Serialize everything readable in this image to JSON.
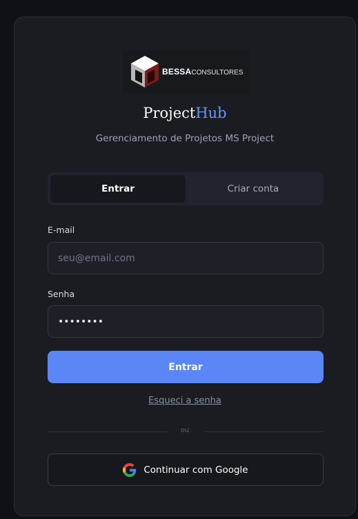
{
  "brand": {
    "logo_bold": "BESSA",
    "logo_light": "CONSULTORES"
  },
  "app": {
    "title_part1": "Project",
    "title_part2": "Hub",
    "subtitle": "Gerenciamento de Projetos MS Project"
  },
  "tabs": [
    {
      "label": "Entrar",
      "active": true
    },
    {
      "label": "Criar conta",
      "active": false
    }
  ],
  "form": {
    "email_label": "E-mail",
    "email_placeholder": "seu@email.com",
    "email_value": "",
    "password_label": "Senha",
    "password_value": "secret12",
    "submit_label": "Entrar",
    "forgot_label": "Esqueci a senha",
    "divider_label": "ou",
    "google_label": "Continuar com Google"
  },
  "colors": {
    "accent": "#5b86f7",
    "title_accent": "#6a95ff",
    "background": "#1a1c22"
  },
  "icons": {
    "logo": "cube-logo-icon",
    "google": "google-icon"
  }
}
